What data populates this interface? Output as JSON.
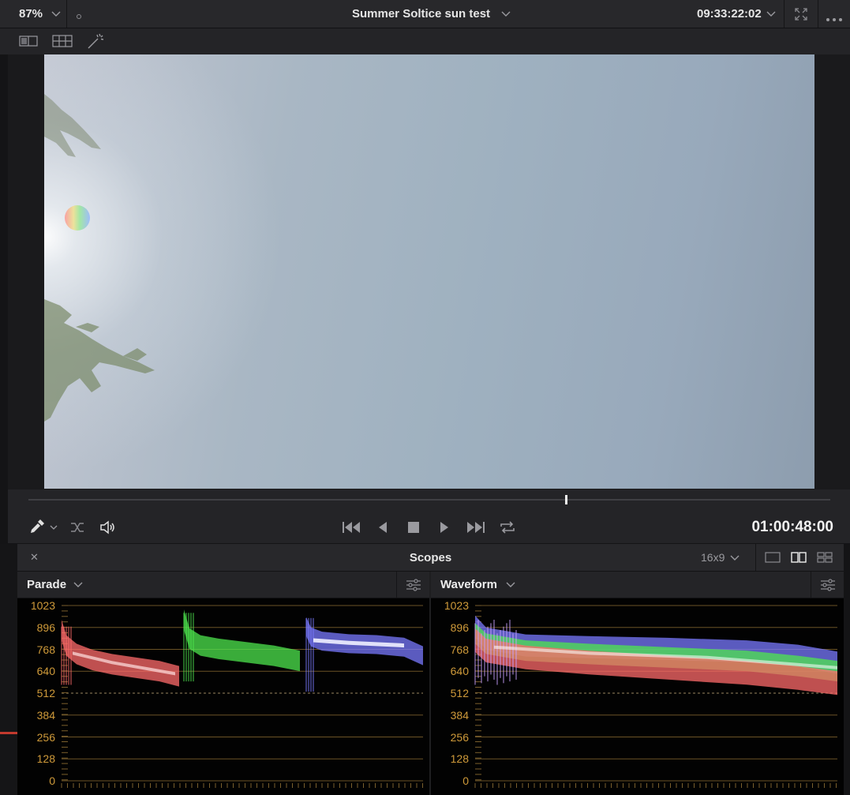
{
  "viewer": {
    "zoom": "87%",
    "clip_title": "Summer Soltice sun test",
    "source_timecode": "09:33:22:02",
    "playhead_timecode": "01:00:48:00",
    "scrub_position": 0.67
  },
  "toolbar": {
    "icons": [
      "split-view-icon",
      "grid-view-icon",
      "magic-wand-icon"
    ]
  },
  "transport": {
    "controls": [
      "eyedropper-icon",
      "shuffle-icon",
      "speaker-icon",
      "jump-start-icon",
      "play-reverse-icon",
      "stop-icon",
      "play-icon",
      "jump-end-icon",
      "loop-icon"
    ]
  },
  "scopes": {
    "title": "Scopes",
    "aspect": "16x9",
    "close_glyph": "✕",
    "left": {
      "mode": "Parade"
    },
    "right": {
      "mode": "Waveform"
    },
    "scale_labels": [
      "1023",
      "896",
      "768",
      "640",
      "512",
      "384",
      "256",
      "128",
      "0"
    ]
  },
  "colors": {
    "accent_orange": "#cf9a3a",
    "red_trace": "#ff6b6b",
    "green_trace": "#4ee64e",
    "blue_trace": "#7a7aff"
  }
}
